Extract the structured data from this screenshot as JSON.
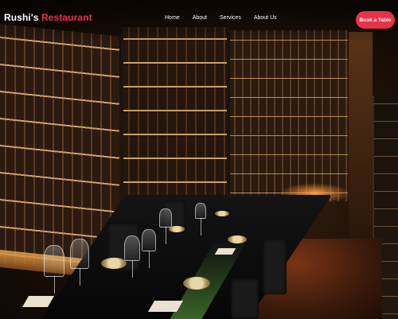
{
  "brand": {
    "name": "Rushi's",
    "accent": "Restaurant"
  },
  "nav": {
    "links": [
      "Home",
      "About",
      "Services",
      "About Us"
    ],
    "cta_label": "Book a Table"
  },
  "hero": {
    "image_icon": "wine-cellar-dining-photo"
  },
  "colors": {
    "accent": "#e8324a",
    "text": "#ffffff"
  }
}
